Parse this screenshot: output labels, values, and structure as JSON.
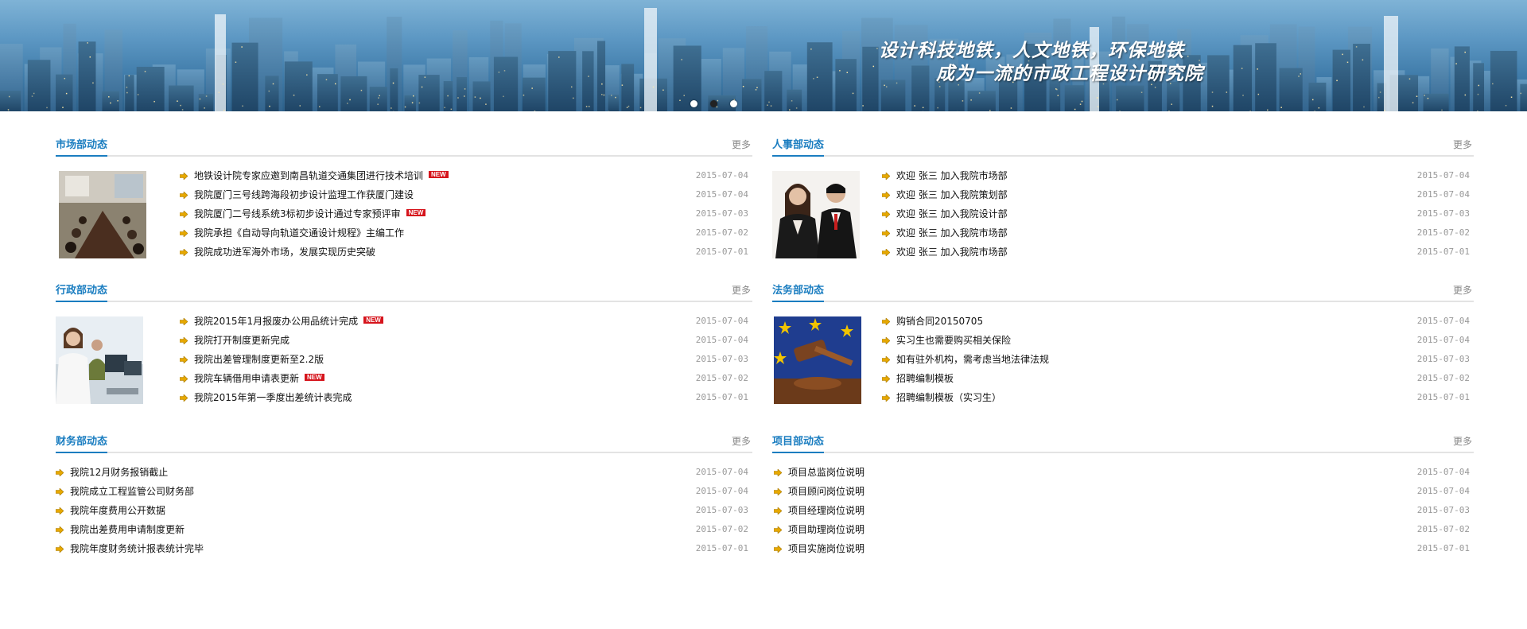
{
  "banner": {
    "slogan_line1": "设计科技地铁，人文地铁，环保地铁",
    "slogan_line2": "成为一流的市政工程设计研究院",
    "slide_count": 3,
    "active_slide": 2
  },
  "more_label": "更多",
  "colors": {
    "accent": "#1a7dc0",
    "date": "#999999",
    "new_badge": "#d6141c",
    "arrow": "#e6a800"
  },
  "sections": {
    "market": {
      "title": "市场部动态",
      "image": "meeting-room-photo",
      "items": [
        {
          "title": "地铁设计院专家应邀到南昌轨道交通集团进行技术培训",
          "date": "2015-07-04",
          "new_label": "NEW"
        },
        {
          "title": "我院厦门三号线跨海段初步设计监理工作获厦门建设",
          "date": "2015-07-04"
        },
        {
          "title": "我院厦门二号线系统3标初步设计通过专家预评审",
          "date": "2015-07-03",
          "new_label": "NEW"
        },
        {
          "title": "我院承担《自动导向轨道交通设计规程》主编工作",
          "date": "2015-07-02"
        },
        {
          "title": "我院成功进军海外市场，发展实现历史突破",
          "date": "2015-07-01"
        }
      ]
    },
    "hr": {
      "title": "人事部动态",
      "image": "business-people-photo",
      "items": [
        {
          "title": "欢迎 张三 加入我院市场部",
          "date": "2015-07-04"
        },
        {
          "title": "欢迎 张三 加入我院策划部",
          "date": "2015-07-04"
        },
        {
          "title": "欢迎 张三 加入我院设计部",
          "date": "2015-07-03"
        },
        {
          "title": "欢迎 张三 加入我院市场部",
          "date": "2015-07-02"
        },
        {
          "title": "欢迎 张三 加入我院市场部",
          "date": "2015-07-01"
        }
      ]
    },
    "admin": {
      "title": "行政部动态",
      "image": "office-workers-photo",
      "items": [
        {
          "title": "我院2015年1月报废办公用品统计完成",
          "date": "2015-07-04",
          "new_label": "NEW"
        },
        {
          "title": "我院打开制度更新完成",
          "date": "2015-07-04"
        },
        {
          "title": "我院出差管理制度更新至2.2版",
          "date": "2015-07-03"
        },
        {
          "title": "我院车辆借用申请表更新",
          "date": "2015-07-02",
          "new_label": "NEW"
        },
        {
          "title": "我院2015年第一季度出差统计表完成",
          "date": "2015-07-01"
        }
      ]
    },
    "legal": {
      "title": "法务部动态",
      "image": "judge-gavel-photo",
      "items": [
        {
          "title": "购销合同20150705",
          "date": "2015-07-04"
        },
        {
          "title": "实习生也需要购买相关保险",
          "date": "2015-07-04"
        },
        {
          "title": "如有驻外机构，需考虑当地法律法规",
          "date": "2015-07-03"
        },
        {
          "title": "招聘编制模板",
          "date": "2015-07-02"
        },
        {
          "title": "招聘编制模板（实习生）",
          "date": "2015-07-01"
        }
      ]
    },
    "finance": {
      "title": "财务部动态",
      "items": [
        {
          "title": "我院12月财务报销截止",
          "date": "2015-07-04"
        },
        {
          "title": "我院成立工程监管公司财务部",
          "date": "2015-07-04"
        },
        {
          "title": "我院年度费用公开数据",
          "date": "2015-07-03"
        },
        {
          "title": "我院出差费用申请制度更新",
          "date": "2015-07-02"
        },
        {
          "title": "我院年度财务统计报表统计完毕",
          "date": "2015-07-01"
        }
      ]
    },
    "project": {
      "title": "项目部动态",
      "items": [
        {
          "title": "项目总监岗位说明",
          "date": "2015-07-04"
        },
        {
          "title": "项目顾问岗位说明",
          "date": "2015-07-04"
        },
        {
          "title": "项目经理岗位说明",
          "date": "2015-07-03"
        },
        {
          "title": "项目助理岗位说明",
          "date": "2015-07-02"
        },
        {
          "title": "项目实施岗位说明",
          "date": "2015-07-01"
        }
      ]
    }
  }
}
